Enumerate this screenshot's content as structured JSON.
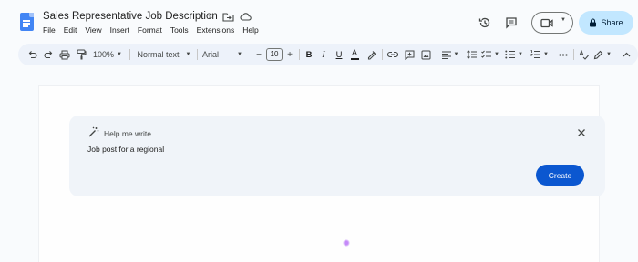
{
  "document": {
    "title": "Sales Representative Job Description"
  },
  "menu": {
    "items": [
      "File",
      "Edit",
      "View",
      "Insert",
      "Format",
      "Tools",
      "Extensions",
      "Help"
    ]
  },
  "share": {
    "label": "Share"
  },
  "toolbar": {
    "zoom": "100%",
    "style": "Normal text",
    "font": "Arial",
    "font_size": "10",
    "minus": "−",
    "plus": "+"
  },
  "help_me_write": {
    "title": "Help me write",
    "input_value": "Job post for a regional",
    "create_label": "Create"
  },
  "colors": {
    "accent": "#0b57d0",
    "share_bg": "#c2e7ff",
    "panel_bg": "#f0f4f9",
    "toolbar_bg": "#edf2fa",
    "docs_blue": "#4285f4"
  }
}
